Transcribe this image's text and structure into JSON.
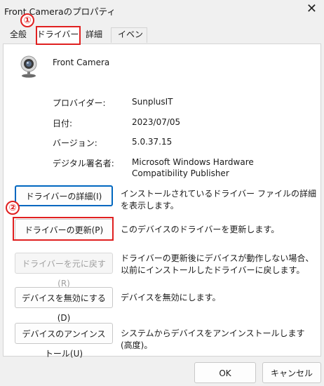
{
  "window": {
    "title": "Front Cameraのプロパティ",
    "close_glyph": "✕"
  },
  "tabs": [
    {
      "label": "全般"
    },
    {
      "label": "ドライバー"
    },
    {
      "label": "詳細"
    },
    {
      "label": "イベント"
    }
  ],
  "device": {
    "name": "Front Camera",
    "icon": "webcam-icon"
  },
  "info": {
    "provider_label": "プロバイダー:",
    "provider_value": "SunplusIT",
    "date_label": "日付:",
    "date_value": "2023/07/05",
    "version_label": "バージョン:",
    "version_value": "5.0.37.15",
    "signer_label": "デジタル署名者:",
    "signer_value": "Microsoft Windows Hardware Compatibility Publisher"
  },
  "actions": [
    {
      "label": "ドライバーの詳細(I)",
      "desc": "インストールされているドライバー ファイルの詳細を表示します。"
    },
    {
      "label": "ドライバーの更新(P)",
      "desc": "このデバイスのドライバーを更新します。"
    },
    {
      "label": "ドライバーを元に戻す(R)",
      "desc": "ドライバーの更新後にデバイスが動作しない場合、以前にインストールしたドライバーに戻します。"
    },
    {
      "label": "デバイスを無効にする(D)",
      "desc": "デバイスを無効にします。"
    },
    {
      "label": "デバイスのアンインストール(U)",
      "desc": "システムからデバイスをアンインストールします (高度)。"
    }
  ],
  "annotations": {
    "marker1": "①",
    "marker2": "②",
    "color": "#e02020"
  },
  "footer": {
    "ok_label": "OK",
    "cancel_label": "キャンセル"
  }
}
